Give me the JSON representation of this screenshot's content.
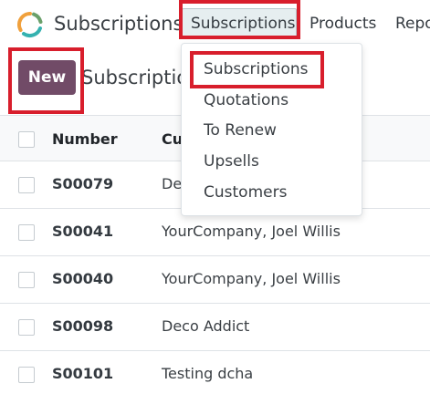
{
  "app": {
    "title": "Subscriptions"
  },
  "nav": {
    "items": [
      {
        "label": "Subscriptions",
        "active": true
      },
      {
        "label": "Products"
      },
      {
        "label": "Repo"
      }
    ]
  },
  "dropdown": {
    "items": [
      {
        "label": "Subscriptions"
      },
      {
        "label": "Quotations"
      },
      {
        "label": "To Renew"
      },
      {
        "label": "Upsells"
      },
      {
        "label": "Customers"
      }
    ]
  },
  "control_panel": {
    "new_label": "New",
    "breadcrumb": "Subscription"
  },
  "table": {
    "columns": [
      "Number",
      "Cu"
    ],
    "rows": [
      {
        "number": "S00079",
        "customer": "De"
      },
      {
        "number": "S00041",
        "customer": "YourCompany, Joel Willis"
      },
      {
        "number": "S00040",
        "customer": "YourCompany, Joel Willis"
      },
      {
        "number": "S00098",
        "customer": "Deco Addict"
      },
      {
        "number": "S00101",
        "customer": "Testing dcha"
      }
    ]
  },
  "colors": {
    "brand": "#714b67",
    "highlight": "#d81e2c",
    "nav_active_bg": "#e6eef0"
  }
}
